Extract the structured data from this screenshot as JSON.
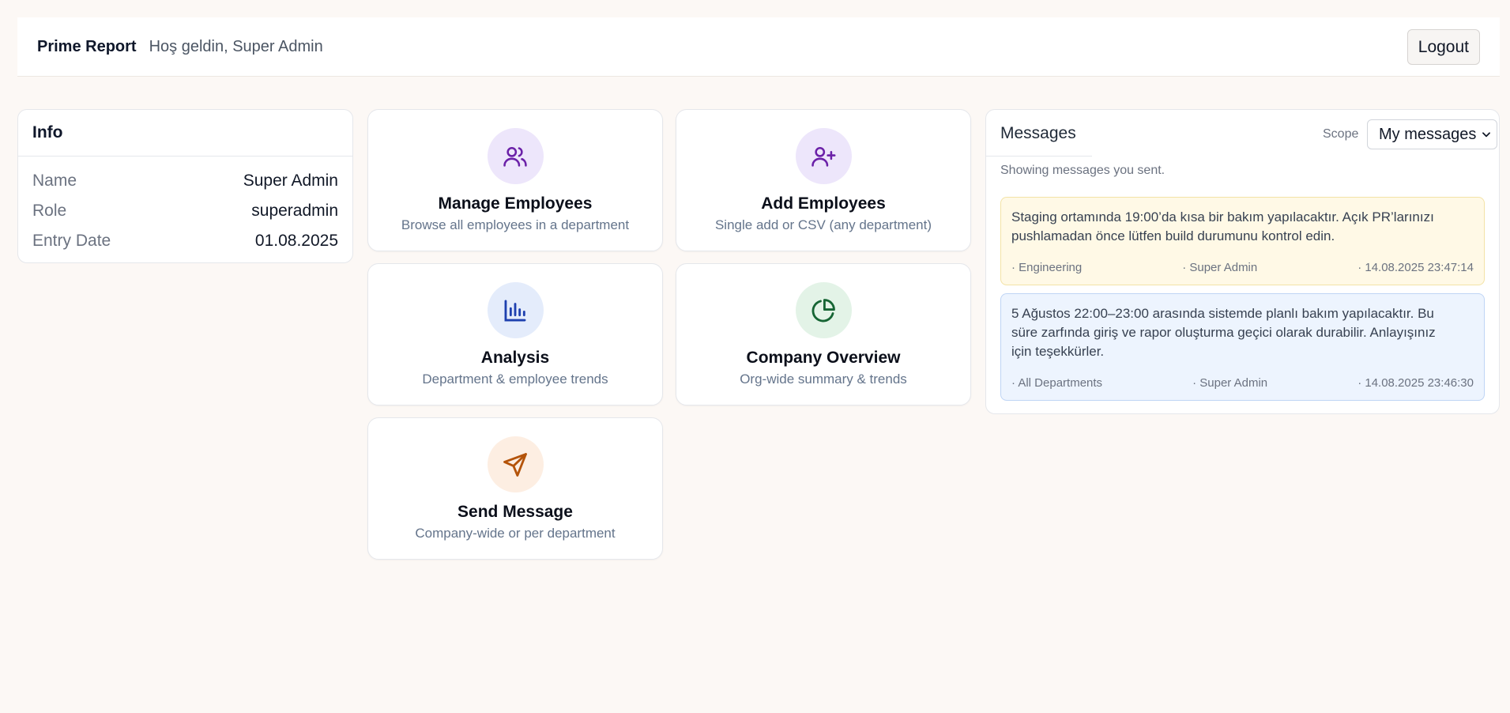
{
  "header": {
    "brand": "Prime Report",
    "welcome": "Hoş geldin, Super Admin",
    "logout_label": "Logout"
  },
  "info": {
    "title": "Info",
    "rows": [
      {
        "label": "Name",
        "value": "Super Admin"
      },
      {
        "label": "Role",
        "value": "superadmin"
      },
      {
        "label": "Entry Date",
        "value": "01.08.2025"
      }
    ]
  },
  "tiles": [
    {
      "title": "Manage Employees",
      "subtitle": "Browse all employees in a department",
      "icon": "users-icon",
      "icon_bg": "#ede6fb",
      "icon_color": "#6b21a8"
    },
    {
      "title": "Add Employees",
      "subtitle": "Single add or CSV (any department)",
      "icon": "user-plus-icon",
      "icon_bg": "#ede6fb",
      "icon_color": "#6b21a8"
    },
    {
      "title": "Analysis",
      "subtitle": "Department & employee trends",
      "icon": "bar-chart-icon",
      "icon_bg": "#e4ecfb",
      "icon_color": "#1e40af"
    },
    {
      "title": "Company Overview",
      "subtitle": "Org-wide summary & trends",
      "icon": "pie-chart-icon",
      "icon_bg": "#e3f3e7",
      "icon_color": "#166534"
    },
    {
      "title": "Send Message",
      "subtitle": "Company-wide or per department",
      "icon": "send-icon",
      "icon_bg": "#fdeee2",
      "icon_color": "#b45309"
    }
  ],
  "messages": {
    "title": "Messages",
    "scope_label": "Scope",
    "scope_value": "My messages",
    "subtitle": "Showing messages you sent.",
    "items": [
      {
        "lines": [
          "Staging ortamında 19:00’da kısa bir bakım yapılacaktır. Açık PR’larınızı",
          "pushlamadan önce lütfen build durumunu kontrol edin."
        ],
        "department": "· Engineering",
        "author": "· Super Admin",
        "time": "· 14.08.2025 23:47:14"
      },
      {
        "lines": [
          "5 Ağustos 22:00–23:00 arasında sistemde planlı bakım yapılacaktır. Bu",
          "süre zarfında giriş ve rapor oluşturma geçici olarak durabilir. Anlayışınız",
          "için teşekkürler."
        ],
        "department": "· All Departments",
        "author": "· Super Admin",
        "time": "· 14.08.2025 23:46:30"
      }
    ]
  }
}
